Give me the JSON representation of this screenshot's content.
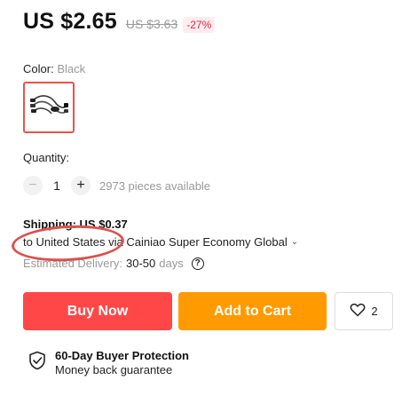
{
  "price": {
    "current": "US $2.65",
    "original": "US $3.63",
    "discount": "-27%"
  },
  "color": {
    "label": "Color:",
    "selected": "Black",
    "swatch_icon": "usb-cable-icon"
  },
  "quantity": {
    "label": "Quantity:",
    "value": "1",
    "minus": "−",
    "plus": "+",
    "available": "2973 pieces available"
  },
  "shipping": {
    "title": "Shipping: US $0.37",
    "method": "to United States via Cainiao Super Economy Global",
    "chevron": "⌄",
    "delivery_label": "Estimated Delivery:",
    "delivery_days": "30-50",
    "delivery_unit": "days",
    "help_icon": "?"
  },
  "actions": {
    "buy_now": "Buy Now",
    "add_to_cart": "Add to Cart",
    "wishlist_count": "2"
  },
  "protection": {
    "title": "60-Day Buyer Protection",
    "subtitle": "Money back guarantee"
  },
  "colors": {
    "buy": "#ff4747",
    "cart": "#ff9a00",
    "highlight": "#d9534f",
    "discount": "#e2273c"
  }
}
